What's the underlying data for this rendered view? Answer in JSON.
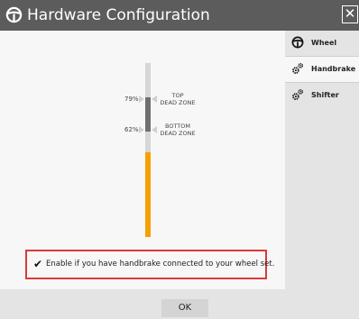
{
  "window": {
    "title": "Hardware Configuration",
    "close_glyph": "✕",
    "icon": "steering-wheel-icon"
  },
  "sidebar": {
    "items": [
      {
        "label": "Wheel",
        "icon": "steering-wheel-icon",
        "active": false
      },
      {
        "label": "Handbrake",
        "icon": "gears-icon",
        "active": true
      },
      {
        "label": "Shifter",
        "icon": "gears-icon",
        "active": false
      }
    ]
  },
  "handbrake": {
    "top_dead_zone": {
      "percent_label": "79%",
      "label": "TOP\nDEAD ZONE",
      "value": 0.79
    },
    "bottom_dead_zone": {
      "percent_label": "62%",
      "label": "BOTTOM\nDEAD ZONE",
      "value": 0.62
    },
    "fill_color": "#f5a000"
  },
  "notice": {
    "check_glyph": "✔",
    "text": "Enable if you have handbrake connected to your wheel set.",
    "border_color": "#d93a3a"
  },
  "footer": {
    "ok_label": "OK"
  },
  "colors": {
    "titlebar": "#5c5c5c",
    "sidebar": "#e4e4e4",
    "accent": "#f5a000"
  }
}
